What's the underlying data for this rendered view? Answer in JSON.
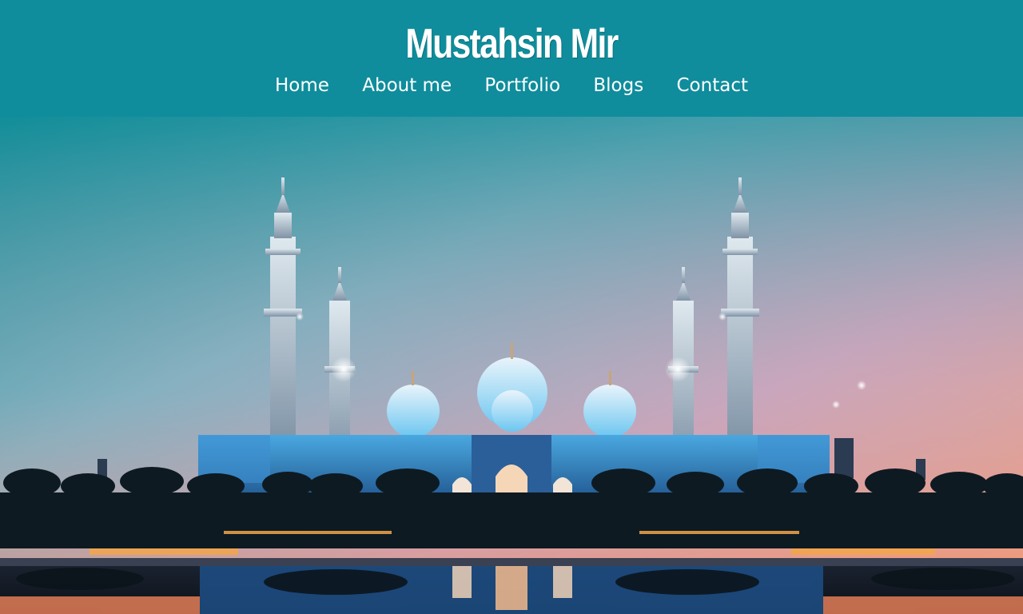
{
  "site": {
    "title": "Mustahsin Mir"
  },
  "nav": {
    "items": [
      {
        "label": "Home"
      },
      {
        "label": "About me"
      },
      {
        "label": "Portfolio"
      },
      {
        "label": "Blogs"
      },
      {
        "label": "Contact"
      }
    ]
  },
  "colors": {
    "header_bg": "#0f8d9c",
    "header_text": "#ffffff",
    "sky_top": "#1d8c98",
    "sky_horizon": "#f0a68a",
    "mosque_glow": "#8fd8ff"
  }
}
